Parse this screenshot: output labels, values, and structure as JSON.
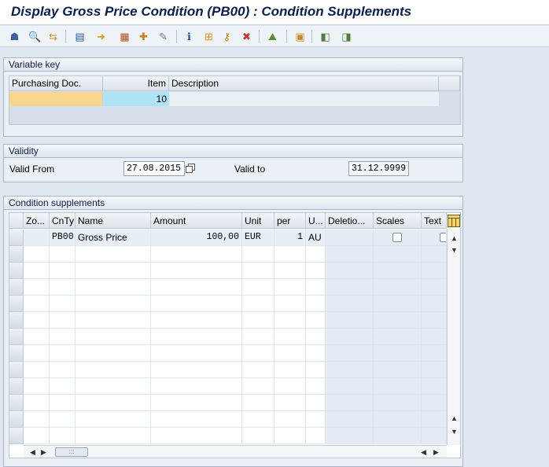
{
  "title": "Display Gross Price Condition (PB00) : Condition Supplements",
  "toolbar": {
    "buttons": [
      {
        "name": "other-condition-icon",
        "glyph": "☗",
        "color": "#3a5f9e"
      },
      {
        "name": "condition-info-icon",
        "glyph": "🔍",
        "color": "#3b6a3a"
      },
      {
        "name": "vendor-icon",
        "glyph": "⇆",
        "color": "#d08a1c"
      },
      {
        "name": "copy-icon",
        "glyph": "▤",
        "color": "#2b5a9c"
      },
      {
        "name": "execute-icon",
        "glyph": "➜",
        "color": "#d39b18"
      },
      {
        "name": "calendar-icon",
        "glyph": "▦",
        "color": "#b44c1c"
      },
      {
        "name": "gift-icon",
        "glyph": "✚",
        "color": "#c77b1a"
      },
      {
        "name": "edit-icon",
        "glyph": "✎",
        "color": "#6c7f95"
      },
      {
        "name": "info-icon",
        "glyph": "ℹ",
        "color": "#1e56a8"
      },
      {
        "name": "scales-icon",
        "glyph": "⊞",
        "color": "#d4942a"
      },
      {
        "name": "key-icon",
        "glyph": "⚷",
        "color": "#b8860b"
      },
      {
        "name": "delete-icon",
        "glyph": "✖",
        "color": "#c0392b"
      },
      {
        "name": "mountain-icon",
        "glyph": "⛰",
        "color": "#5b8c3a"
      },
      {
        "name": "clipboard-icon",
        "glyph": "▣",
        "color": "#c98a2a"
      },
      {
        "name": "doc-prev-icon",
        "glyph": "◧",
        "color": "#4f7d3a"
      },
      {
        "name": "doc-next-icon",
        "glyph": "◨",
        "color": "#4f7d3a"
      }
    ]
  },
  "variable_key": {
    "header": "Variable key",
    "columns": [
      "Purchasing Doc.",
      "Item",
      "Description"
    ],
    "row": {
      "purchasing_doc": "",
      "item": "10",
      "description": ""
    }
  },
  "validity": {
    "header": "Validity",
    "valid_from_label": "Valid From",
    "valid_from": "27.08.2015",
    "valid_to_label": "Valid to",
    "valid_to": "31.12.9999"
  },
  "supplements": {
    "header": "Condition supplements",
    "columns": [
      "Zo...",
      "CnTy",
      "Name",
      "Amount",
      "Unit",
      "per",
      "U...",
      "Deletio...",
      "Scales",
      "Text"
    ],
    "rows": [
      {
        "zo": "",
        "cnty": "PB00",
        "name": "Gross Price",
        "amount": "100,00",
        "unit": "EUR",
        "per": "1",
        "uom": "AU",
        "deletion": "",
        "scales": false,
        "text": false
      }
    ],
    "empty_rows": 12
  },
  "colors": {
    "key_field": "#fbd68e",
    "item_field": "#aee4f5",
    "focus_marker": "#c2352a"
  }
}
